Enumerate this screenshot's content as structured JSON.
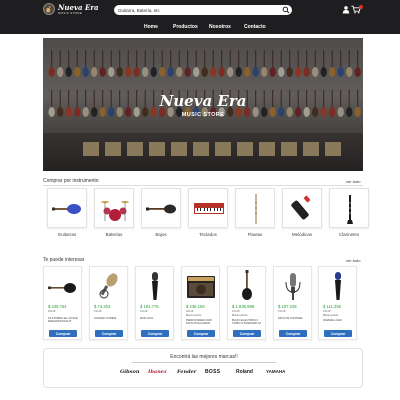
{
  "header": {
    "logo_title": "Nueva Era",
    "logo_sub": "MUSIC STORE",
    "search_value": "Guitarra, Batería, etc",
    "nav": [
      "Home",
      "Productos",
      "Nosotros",
      "Contacto"
    ],
    "icons": [
      "search-icon",
      "user-icon",
      "cart-icon"
    ]
  },
  "hero": {
    "title": "Nueva Era",
    "subtitle": "MUSIC STORE"
  },
  "categories": {
    "title": "Comprar por instrumento",
    "see_all": "ver todo",
    "items": [
      "Guitarras",
      "Baterías",
      "Bajos",
      "Teclados",
      "Flautas",
      "Melódicas",
      "Clarinetes"
    ]
  },
  "products": {
    "title": "Te puede interesar",
    "see_all": "ver todo",
    "buy_label": "Comprar",
    "items": [
      {
        "price": "$ 449.764",
        "note": "4% off",
        "name": "GUITARRA EL CIOCE DREADNOUGHT"
      },
      {
        "price": "$ 74.203",
        "note": "1% off",
        "name": "CAMAR VOMFE"
      },
      {
        "price": "$ 181.776",
        "note": "1% off",
        "name": "ECD AKG"
      },
      {
        "price": "$ 238.159",
        "note": "4% off",
        "note2": "Mismo precio",
        "name": "Pedfonder 20W 10L5 polgadas"
      },
      {
        "price": "$ 1.835.998",
        "note": "1% off",
        "note2": "Mismo precio",
        "name": "BAJO ELECTRICO TOBO STANDARD M"
      },
      {
        "price": "$ 187.228",
        "note": "1% off",
        "name": "MAYUSI KIKONEL"
      },
      {
        "price": "$ 111.256",
        "note": "2% off",
        "note2": "Mismo precio",
        "name": "SMADE LG90"
      }
    ]
  },
  "brands": {
    "title": "Encontrá las mejores marcas!!",
    "items": [
      "Gibson",
      "Ibanez",
      "Fender",
      "BOSS",
      "Roland",
      "YAMAHA"
    ]
  },
  "colors": {
    "topbar": "#1e1e20",
    "price": "#2a9d3a",
    "button": "#2f6fbf",
    "cart_badge": "#e0322a"
  }
}
